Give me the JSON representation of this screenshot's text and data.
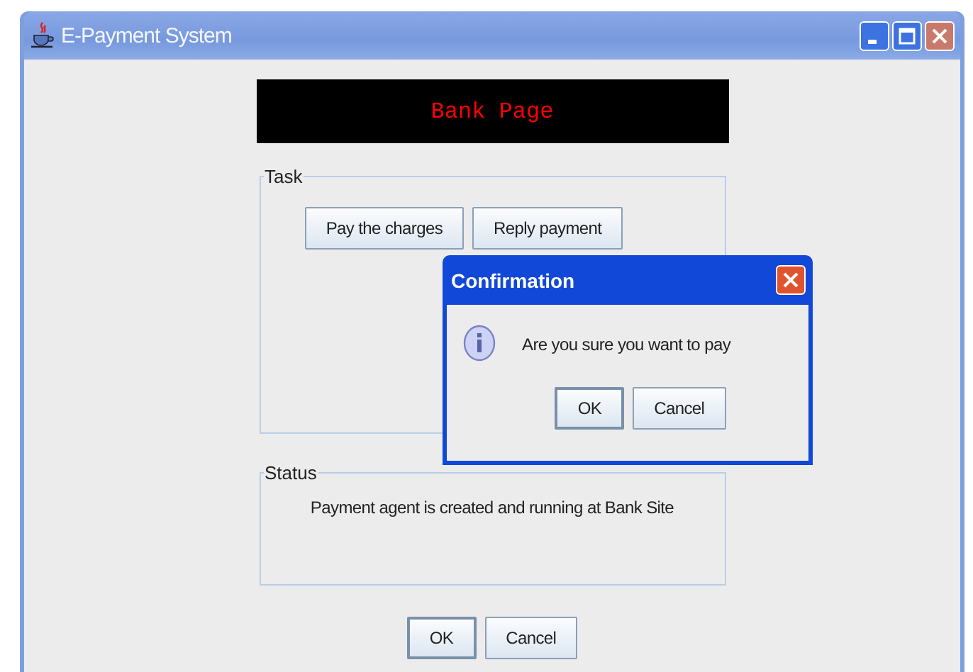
{
  "window": {
    "title": "E-Payment System"
  },
  "banner": {
    "text": "Bank Page"
  },
  "task": {
    "legend": "Task",
    "buttons": [
      {
        "label": "Pay the charges",
        "default": false
      },
      {
        "label": "Reply payment",
        "default": false
      }
    ]
  },
  "status": {
    "legend": "Status",
    "message": "Payment agent is created and running at Bank Site"
  },
  "buttons": [
    {
      "label": "OK",
      "default": true
    },
    {
      "label": "Cancel",
      "default": false
    }
  ],
  "dialog": {
    "title": "Confirmation",
    "message": "Are you sure you want to pay",
    "buttons": [
      {
        "label": "OK",
        "default": true
      },
      {
        "label": "Cancel",
        "default": false
      }
    ]
  }
}
